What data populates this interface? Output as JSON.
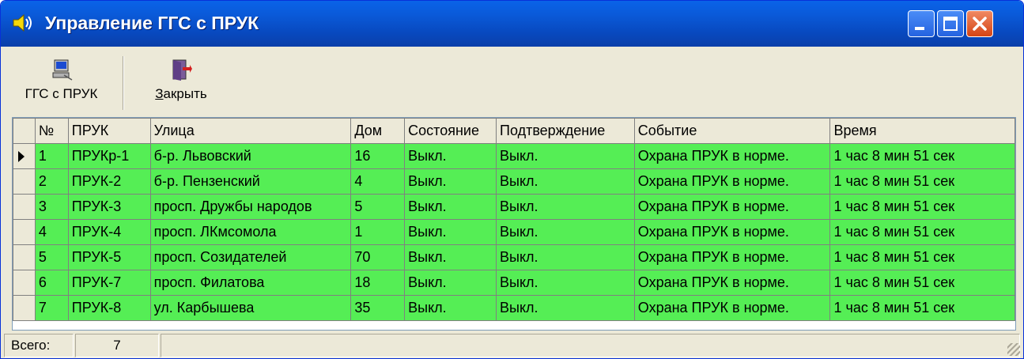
{
  "window": {
    "title": "Управление ГГС с ПРУК",
    "title_icon": "speaker-icon",
    "controls": [
      "minimize-icon",
      "maximize-icon",
      "close-icon"
    ],
    "titlebar_color": "#0a5ad9"
  },
  "toolbar": {
    "ggs_label": "ГГС с ПРУК",
    "ggs_icon": "computer-icon",
    "close_label": "Закрыть",
    "close_icon": "exit-door-icon"
  },
  "grid": {
    "row_color": "#55ee55",
    "columns": [
      "№",
      "ПРУК",
      "Улица",
      "Дом",
      "Состояние",
      "Подтверждение",
      "Событие",
      "Время"
    ],
    "rows": [
      [
        "1",
        "ПРУКр-1",
        "б-р. Львовский",
        "16",
        "Выкл.",
        "Выкл.",
        "Охрана ПРУК в норме.",
        "1 час  8 мин 51 сек"
      ],
      [
        "2",
        "ПРУК-2",
        "б-р. Пензенский",
        "4",
        "Выкл.",
        "Выкл.",
        "Охрана ПРУК в норме.",
        "1 час  8 мин 51 сек"
      ],
      [
        "3",
        "ПРУК-3",
        "просп. Дружбы народов",
        "5",
        "Выкл.",
        "Выкл.",
        "Охрана ПРУК в норме.",
        "1 час  8 мин 51 сек"
      ],
      [
        "4",
        "ПРУК-4",
        "просп. ЛКмсомола",
        "1",
        "Выкл.",
        "Выкл.",
        "Охрана ПРУК в норме.",
        "1 час  8 мин 51 сек"
      ],
      [
        "5",
        "ПРУК-5",
        "просп. Созидателей",
        "70",
        "Выкл.",
        "Выкл.",
        "Охрана ПРУК в норме.",
        "1 час  8 мин 51 сек"
      ],
      [
        "6",
        "ПРУК-7",
        "просп. Филатова",
        "18",
        "Выкл.",
        "Выкл.",
        "Охрана ПРУК в норме.",
        "1 час  8 мин 51 сек"
      ],
      [
        "7",
        "ПРУК-8",
        "ул. Карбышева",
        "35",
        "Выкл.",
        "Выкл.",
        "Охрана ПРУК в норме.",
        "1 час  8 мин 51 сек"
      ]
    ]
  },
  "status": {
    "total_label": "Всего:",
    "total_value": "7"
  }
}
